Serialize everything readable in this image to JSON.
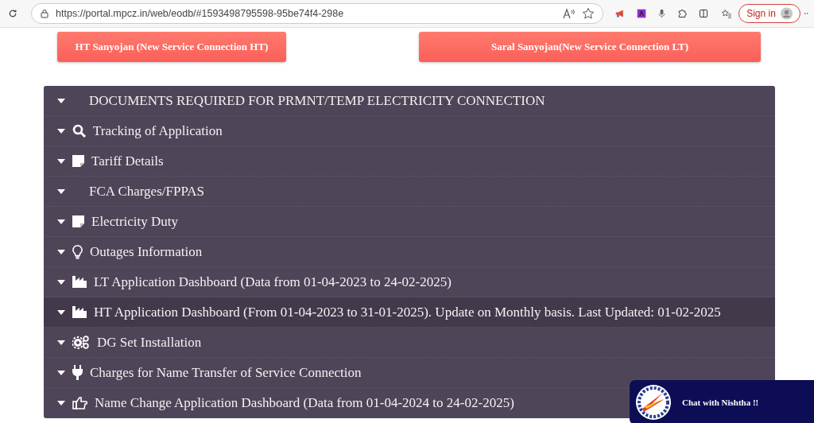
{
  "browser": {
    "url": "https://portal.mpcz.in/web/eodb/#1593498795598-95be74f4-298e",
    "sign_in": "Sign in"
  },
  "buttons": [
    "HT Sanyojan (New Service Connection HT)",
    "Saral Sanyojan(New Service Connection LT)"
  ],
  "accordion": [
    {
      "label": "DOCUMENTS REQUIRED FOR PRMNT/TEMP ELECTRICITY CONNECTION",
      "kind": "none",
      "highlighted": false
    },
    {
      "label": "Tracking of Application",
      "kind": "search",
      "highlighted": false
    },
    {
      "label": "Tariff Details",
      "kind": "note",
      "highlighted": false
    },
    {
      "label": "FCA Charges/FPPAS",
      "kind": "none",
      "highlighted": false
    },
    {
      "label": "Electricity Duty",
      "kind": "note",
      "highlighted": false
    },
    {
      "label": "Outages Information",
      "kind": "bulb",
      "highlighted": false
    },
    {
      "label": "LT Application Dashboard (Data from 01-04-2023 to 24-02-2025)",
      "kind": "factory",
      "highlighted": false
    },
    {
      "label": "HT Application Dashboard (From 01-04-2023 to 31-01-2025). Update on Monthly basis. Last Updated: 01-02-2025",
      "kind": "factory",
      "highlighted": true
    },
    {
      "label": "DG Set Installation",
      "kind": "gears",
      "highlighted": false
    },
    {
      "label": "Charges for Name Transfer of Service Connection",
      "kind": "plug",
      "highlighted": false
    },
    {
      "label": "Name Change Application Dashboard (Data from 01-04-2024 to 24-02-2025)",
      "kind": "thumb",
      "highlighted": false
    }
  ],
  "chat": {
    "label": "Chat with Nishtha !!"
  }
}
